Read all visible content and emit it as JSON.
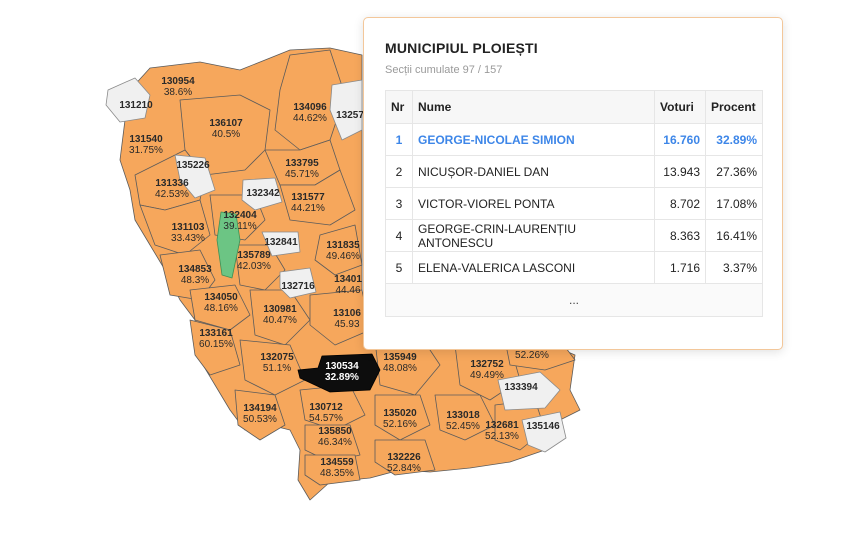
{
  "popup": {
    "title": "MUNICIPIUL PLOIEȘTI",
    "subtitle": "Secții cumulate 97 / 157",
    "columns": [
      "Nr",
      "Nume",
      "Voturi",
      "Procent"
    ],
    "rows": [
      {
        "nr": "1",
        "name": "GEORGE-NICOLAE SIMION",
        "votes": "16.760",
        "pct": "32.89%"
      },
      {
        "nr": "2",
        "name": "NICUȘOR-DANIEL DAN",
        "votes": "13.943",
        "pct": "27.36%"
      },
      {
        "nr": "3",
        "name": "VICTOR-VIOREL PONTA",
        "votes": "8.702",
        "pct": "17.08%"
      },
      {
        "nr": "4",
        "name": "GEORGE-CRIN-LAURENȚIU ANTONESCU",
        "votes": "8.363",
        "pct": "16.41%"
      },
      {
        "nr": "5",
        "name": "ELENA-VALERICA LASCONI",
        "votes": "1.716",
        "pct": "3.37%"
      }
    ],
    "more": "..."
  },
  "map": {
    "colors": {
      "orange": "#f6a75c",
      "white": "#f0f0f0",
      "green": "#6cc584",
      "selected": "#0d0d0d",
      "highlight_text": "#3d86e8"
    },
    "labels": [
      {
        "code": "130954",
        "pct": "38.6%"
      },
      {
        "code": "131210",
        "pct": ""
      },
      {
        "code": "136107",
        "pct": "40.5%"
      },
      {
        "code": "134096",
        "pct": "44.62%"
      },
      {
        "code": "13257",
        "pct": ""
      },
      {
        "code": "131540",
        "pct": "31.75%"
      },
      {
        "code": "135226",
        "pct": ""
      },
      {
        "code": "133795",
        "pct": "45.71%"
      },
      {
        "code": "131336",
        "pct": "42.53%"
      },
      {
        "code": "132342",
        "pct": ""
      },
      {
        "code": "131577",
        "pct": "44.21%"
      },
      {
        "code": "132404",
        "pct": "39.11%"
      },
      {
        "code": "131103",
        "pct": "33.43%"
      },
      {
        "code": "132841",
        "pct": ""
      },
      {
        "code": "131835",
        "pct": "49.46%"
      },
      {
        "code": "135789",
        "pct": "42.03%"
      },
      {
        "code": "134853",
        "pct": "48.3%"
      },
      {
        "code": "13401",
        "pct": "44.46"
      },
      {
        "code": "132716",
        "pct": ""
      },
      {
        "code": "134050",
        "pct": "48.16%"
      },
      {
        "code": "130981",
        "pct": "40.47%"
      },
      {
        "code": "13106",
        "pct": "45.93"
      },
      {
        "code": "133161",
        "pct": "60.15%"
      },
      {
        "code": "132075",
        "pct": "51.1%"
      },
      {
        "code": "130534",
        "pct": "32.89%"
      },
      {
        "code": "135949",
        "pct": "48.08%"
      },
      {
        "code": "132752",
        "pct": "49.49%"
      },
      {
        "code": "",
        "pct": "52.26%"
      },
      {
        "code": "133394",
        "pct": ""
      },
      {
        "code": "134194",
        "pct": "50.53%"
      },
      {
        "code": "130712",
        "pct": "54.57%"
      },
      {
        "code": "135020",
        "pct": "52.16%"
      },
      {
        "code": "133018",
        "pct": "52.45%"
      },
      {
        "code": "132681",
        "pct": "52.13%"
      },
      {
        "code": "135146",
        "pct": ""
      },
      {
        "code": "135850",
        "pct": "46.34%"
      },
      {
        "code": "132226",
        "pct": "52.84%"
      },
      {
        "code": "134559",
        "pct": "48.35%"
      }
    ]
  }
}
